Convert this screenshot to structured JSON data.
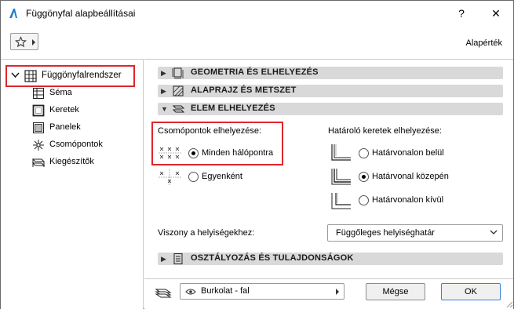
{
  "window": {
    "title": "Függönyfal alapbeállításai",
    "help_label": "?",
    "close_label": "✕"
  },
  "toolbar": {
    "favorites_icon": "star-icon",
    "defaults_label": "Alapérték"
  },
  "tree": {
    "root_label": "Függönyfalrendszer",
    "items": [
      {
        "label": "Séma",
        "icon": "scheme-icon"
      },
      {
        "label": "Keretek",
        "icon": "frame-icon"
      },
      {
        "label": "Panelek",
        "icon": "panel-icon"
      },
      {
        "label": "Csomópontok",
        "icon": "junction-icon"
      },
      {
        "label": "Kiegészítők",
        "icon": "accessory-icon"
      }
    ]
  },
  "sections": {
    "geometry": "GEOMETRIA ÉS ELHELYEZÉS",
    "plan": "ALAPRAJZ ÉS METSZET",
    "element": "ELEM ELHELYEZÉS",
    "classification": "OSZTÁLYOZÁS ÉS TULAJDONSÁGOK"
  },
  "element_placement": {
    "junction_title": "Csomópontok elhelyezése:",
    "junction_options": [
      {
        "label": "Minden hálópontra",
        "selected": true
      },
      {
        "label": "Egyenként",
        "selected": false
      }
    ],
    "frame_title": "Határoló keretek elhelyezése:",
    "frame_options": [
      {
        "label": "Határvonalon belül",
        "selected": false
      },
      {
        "label": "Határvonal közepén",
        "selected": true
      },
      {
        "label": "Határvonalon kívül",
        "selected": false
      }
    ]
  },
  "zone_relation": {
    "label": "Viszony a helyiségekhez:",
    "value": "Függőleges helyiséghatár"
  },
  "footer": {
    "layer_value": "Burkolat - fal",
    "cancel_label": "Mégse",
    "ok_label": "OK"
  },
  "colors": {
    "highlight": "#e0262c",
    "section_bar": "#d9d9d9",
    "default_button_border": "#3b7ddd"
  }
}
